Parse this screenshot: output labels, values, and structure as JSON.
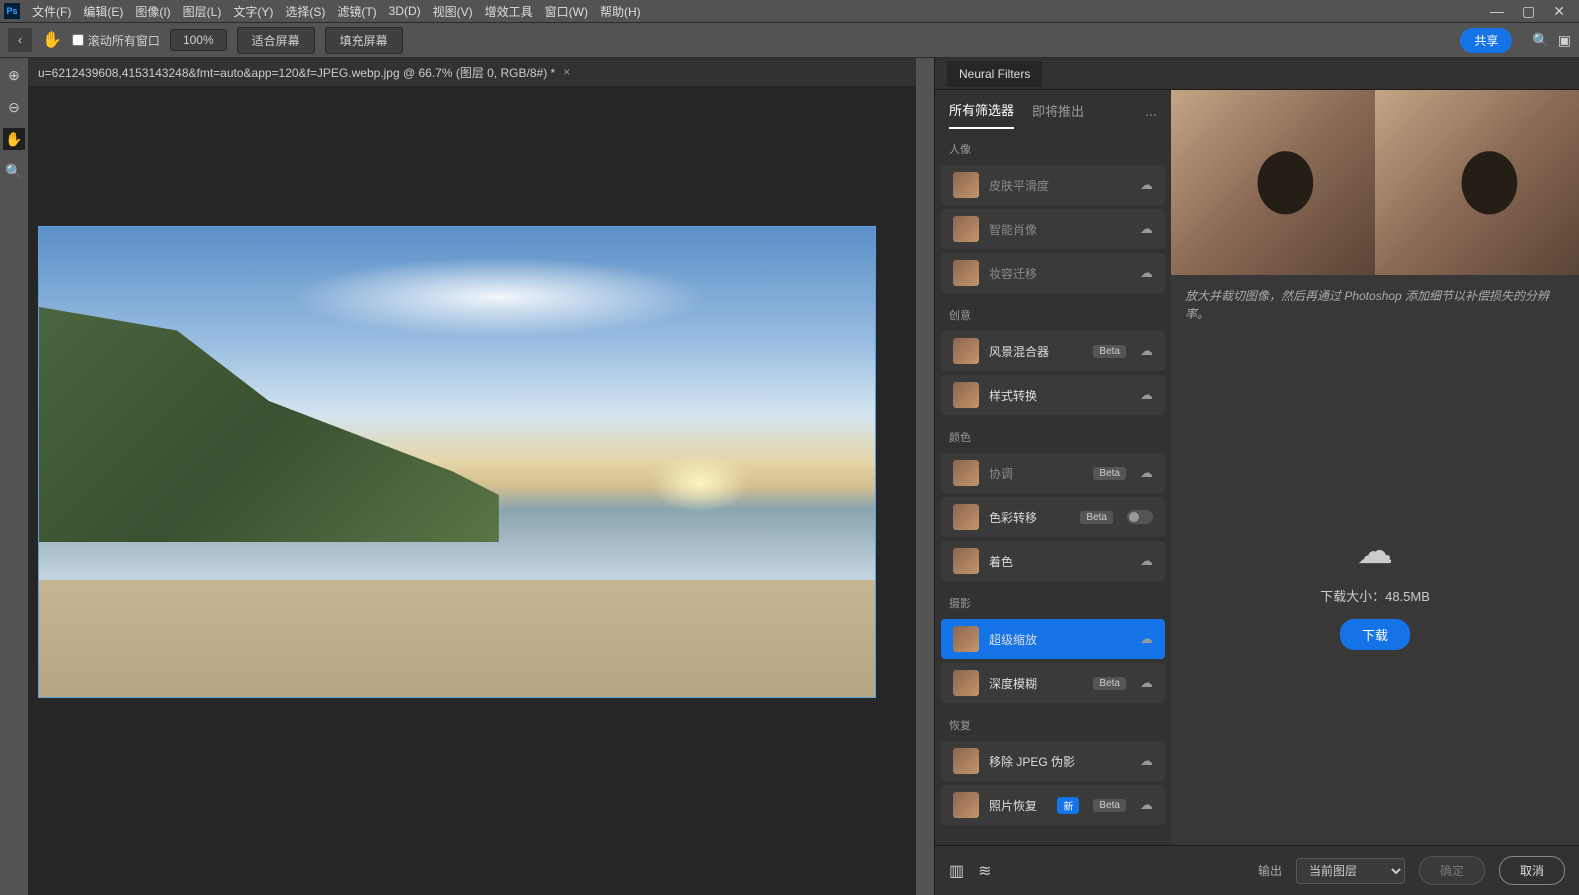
{
  "menubar": {
    "items": [
      "文件(F)",
      "编辑(E)",
      "图像(I)",
      "图层(L)",
      "文字(Y)",
      "选择(S)",
      "滤镜(T)",
      "3D(D)",
      "视图(V)",
      "增效工具",
      "窗口(W)",
      "帮助(H)"
    ]
  },
  "toolbar": {
    "scroll_all": "滚动所有窗口",
    "zoom": "100%",
    "fit_screen": "适合屏幕",
    "fill_screen": "填充屏幕",
    "share": "共享"
  },
  "doc_tab": {
    "title": "u=6212439608,4153143248&fmt=auto&app=120&f=JPEG.webp.jpg @ 66.7% (图层 0, RGB/8#) *"
  },
  "neural": {
    "header_tab": "Neural Filters",
    "tabs": {
      "all": "所有筛选器",
      "upcoming": "即将推出"
    },
    "categories": {
      "portrait": "人像",
      "creative": "创意",
      "color": "颜色",
      "photo": "摄影",
      "restore": "恢复"
    },
    "filters": {
      "skin": "皮肤平滑度",
      "smart_portrait": "智能肖像",
      "makeup": "妆容迁移",
      "landscape": "风景混合器",
      "style": "样式转换",
      "harmonize": "协调",
      "color_transfer": "色彩转移",
      "colorize": "着色",
      "super_zoom": "超级缩放",
      "depth_blur": "深度模糊",
      "jpeg": "移除 JPEG 伪影",
      "photo_restore": "照片恢复"
    },
    "badges": {
      "beta": "Beta",
      "new": "新"
    },
    "detail": {
      "description": "放大并裁切图像，然后再通过 Photoshop 添加细节以补偿损失的分辨率。",
      "size_label": "下载大小：",
      "size_value": "48.5MB",
      "download": "下载"
    },
    "footer": {
      "output_label": "输出",
      "output_value": "当前图层",
      "ok": "确定",
      "cancel": "取消"
    }
  }
}
